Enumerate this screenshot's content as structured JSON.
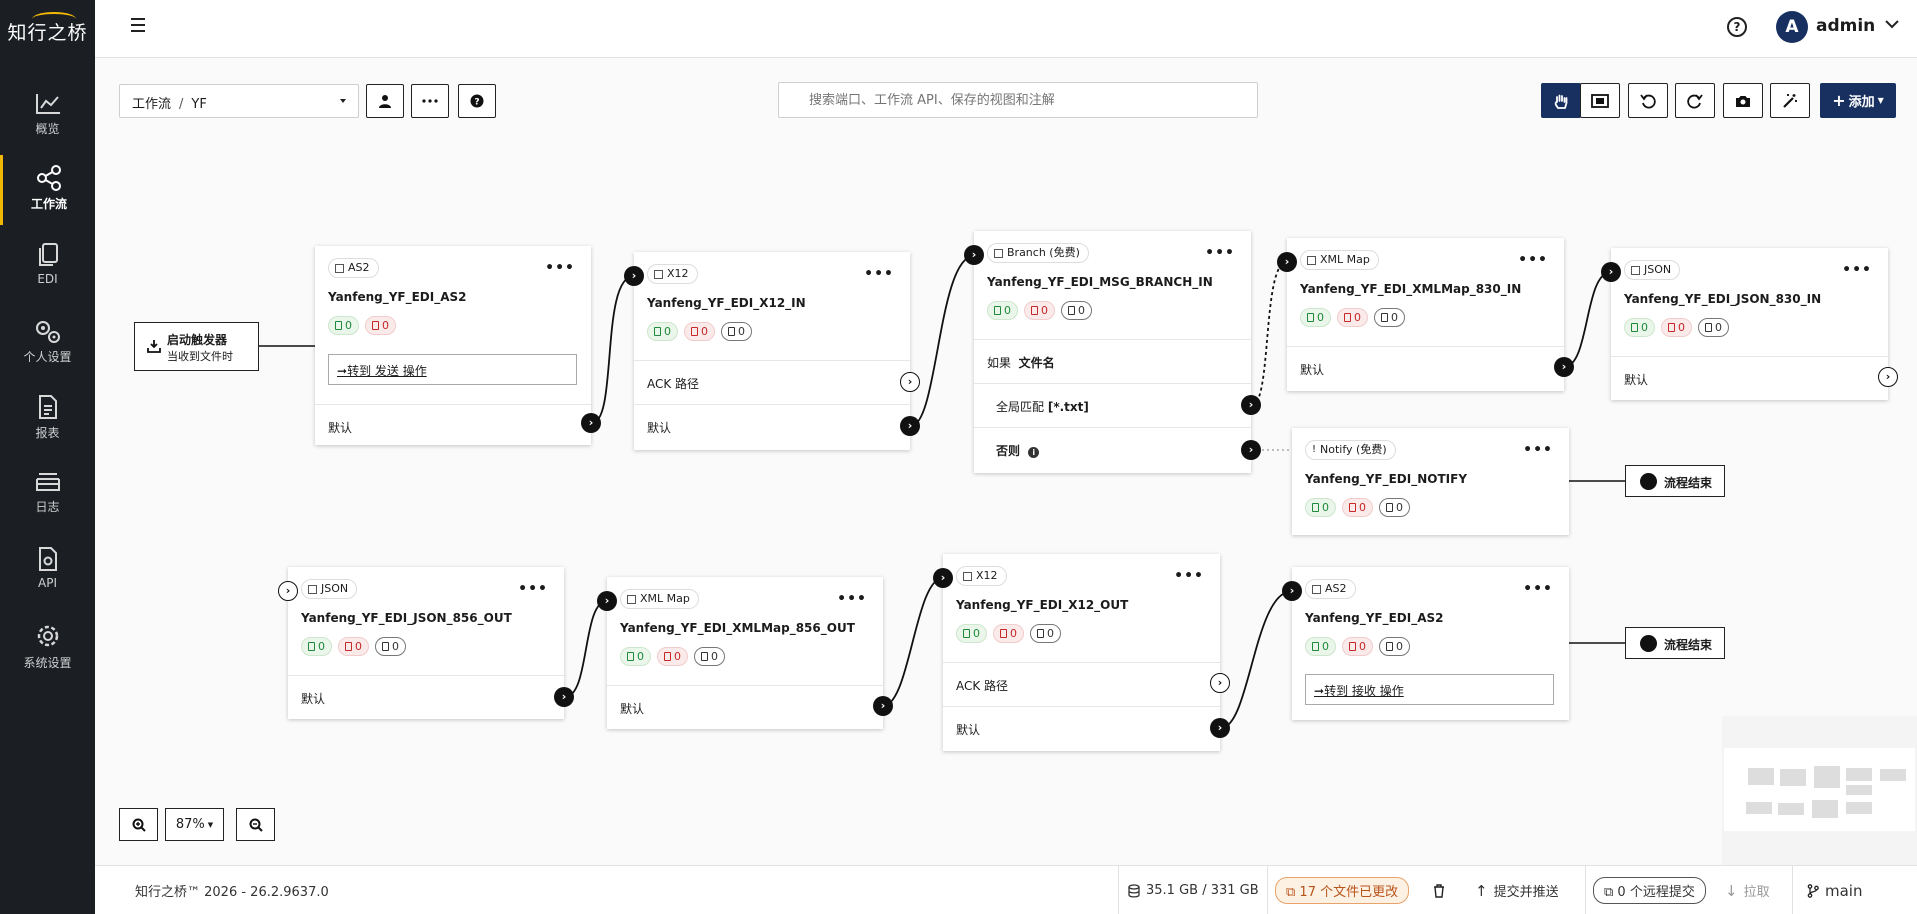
{
  "app": {
    "logo": "知行之桥"
  },
  "sidebar": {
    "items": [
      {
        "label": "概览",
        "icon": "chart-line-icon"
      },
      {
        "label": "工作流",
        "icon": "share-nodes-icon",
        "active": true
      },
      {
        "label": "EDI",
        "icon": "documents-icon"
      },
      {
        "label": "个人设置",
        "icon": "user-gears-icon"
      },
      {
        "label": "报表",
        "icon": "report-icon"
      },
      {
        "label": "日志",
        "icon": "log-stack-icon"
      },
      {
        "label": "API",
        "icon": "api-file-icon"
      },
      {
        "label": "系统设置",
        "icon": "settings-gear-icon"
      }
    ]
  },
  "header": {
    "avatar_letter": "A",
    "username": "admin"
  },
  "toolbar": {
    "breadcrumb_root": "工作流",
    "breadcrumb_sep": "/",
    "breadcrumb_current": "YF",
    "search_placeholder": "搜索端口、工作流 API、保存的视图和注解",
    "add_label": "添加"
  },
  "trigger": {
    "title": "启动触发器",
    "subtitle": "当收到文件时"
  },
  "nodes": {
    "as2_in": {
      "type": "AS2",
      "name": "Yanfeng_YF_EDI_AS2",
      "g": "0",
      "r": "0",
      "action": "转到 发送 操作",
      "row1": "默认"
    },
    "x12_in": {
      "type": "X12",
      "name": "Yanfeng_YF_EDI_X12_IN",
      "g": "0",
      "r": "0",
      "n": "0",
      "row1": "ACK 路径",
      "row2": "默认"
    },
    "branch": {
      "type": "Branch (免费)",
      "name": "Yanfeng_YF_EDI_MSG_BRANCH_IN",
      "g": "0",
      "r": "0",
      "n": "0",
      "if_label": "如果",
      "if_field": "文件名",
      "match_label": "全局匹配",
      "match_value": "[*.txt]",
      "else_label": "否则"
    },
    "xmlmap_830": {
      "type": "XML Map",
      "name": "Yanfeng_YF_EDI_XMLMap_830_IN",
      "g": "0",
      "r": "0",
      "n": "0",
      "row1": "默认"
    },
    "json_830": {
      "type": "JSON",
      "name": "Yanfeng_YF_EDI_JSON_830_IN",
      "g": "0",
      "r": "0",
      "n": "0",
      "row1": "默认"
    },
    "notify": {
      "type": "Notify (免费)",
      "name": "Yanfeng_YF_EDI_NOTIFY",
      "g": "0",
      "r": "0",
      "n": "0"
    },
    "json_856": {
      "type": "JSON",
      "name": "Yanfeng_YF_EDI_JSON_856_OUT",
      "g": "0",
      "r": "0",
      "n": "0",
      "row1": "默认"
    },
    "xmlmap_856": {
      "type": "XML Map",
      "name": "Yanfeng_YF_EDI_XMLMap_856_OUT",
      "g": "0",
      "r": "0",
      "n": "0",
      "row1": "默认"
    },
    "x12_out": {
      "type": "X12",
      "name": "Yanfeng_YF_EDI_X12_OUT",
      "g": "0",
      "r": "0",
      "n": "0",
      "row1": "ACK 路径",
      "row2": "默认"
    },
    "as2_out": {
      "type": "AS2",
      "name": "Yanfeng_YF_EDI_AS2",
      "g": "0",
      "r": "0",
      "n": "0",
      "action": "转到 接收 操作"
    }
  },
  "end_label": "流程结束",
  "zoom": {
    "level": "87%"
  },
  "footer": {
    "version": "知行之桥™ 2026 - 26.2.9637.0",
    "storage": "35.1 GB / 331 GB",
    "changed": "17 个文件已更改",
    "commit_push": "提交并推送",
    "remote": "0 个远程提交",
    "pull": "拉取",
    "branch": "main"
  },
  "colors": {
    "sidebar_bg": "#1b1f24",
    "accent": "#f2b705",
    "primary": "#17305f",
    "success": "#1f8a3a",
    "danger": "#c62828"
  }
}
